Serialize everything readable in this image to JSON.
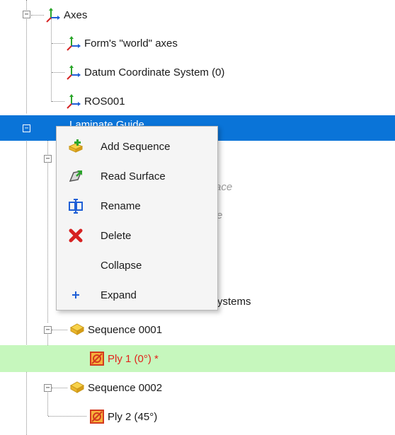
{
  "tree": {
    "axes": {
      "label": "Axes",
      "children": [
        "Form's \"world\" axes",
        "Datum Coordinate System (0)",
        "ROS001"
      ]
    },
    "selected_node": {
      "label": "Laminate Guide"
    },
    "behind_menu": {
      "surface_a": "ace",
      "surface_b": "e",
      "systems": "Systems"
    },
    "sequence_1": {
      "label": "Sequence 0001",
      "ply": "Ply 1 (0°) *"
    },
    "sequence_2": {
      "label": "Sequence 0002",
      "ply": "Ply 2 (45°)"
    },
    "toggles": {
      "expanded": "−"
    }
  },
  "context_menu": {
    "items": [
      {
        "label": "Add Sequence",
        "icon": "add-sequence-icon"
      },
      {
        "label": "Read Surface",
        "icon": "read-surface-icon"
      },
      {
        "label": "Rename",
        "icon": "rename-icon"
      },
      {
        "label": "Delete",
        "icon": "delete-icon"
      },
      {
        "label": "Collapse",
        "icon": ""
      },
      {
        "label": "Expand",
        "icon": "plus-icon"
      }
    ]
  },
  "colors": {
    "selection": "#0a74d8",
    "highlight_row": "#c6f7bd",
    "ply_text": "#e2231a",
    "menu_bg": "#f5f5f5"
  }
}
